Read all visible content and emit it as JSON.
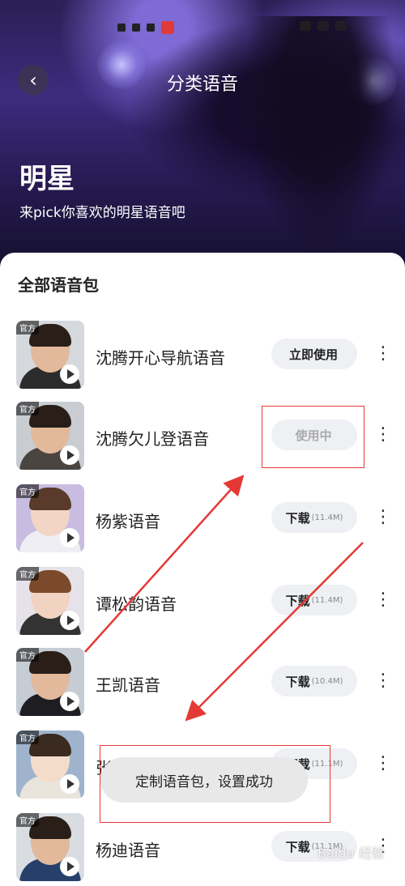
{
  "header": {
    "title": "分类语音",
    "back_label": "‹"
  },
  "hero": {
    "title": "明星",
    "subtitle": "来pick你喜欢的明星语音吧"
  },
  "section_title": "全部语音包",
  "badge": "官方",
  "items": [
    {
      "name": "沈腾开心导航语音",
      "action": "立即使用",
      "size": ""
    },
    {
      "name": "沈腾欠儿登语音",
      "action": "使用中",
      "size": ""
    },
    {
      "name": "杨紫语音",
      "action": "下载",
      "size": "(11.4M)"
    },
    {
      "name": "谭松韵语音",
      "action": "下载",
      "size": "(11.4M)"
    },
    {
      "name": "王凯语音",
      "action": "下载",
      "size": "(10.4M)"
    },
    {
      "name": "张雪迎语音",
      "action": "下载",
      "size": "(11.1M)"
    },
    {
      "name": "杨迪语音",
      "action": "下载",
      "size": "(11.1M)"
    }
  ],
  "toast": "定制语音包，设置成功",
  "watermark": "Baidu 经验",
  "colors": {
    "annotation": "#e53935",
    "button_bg": "#eef0f4"
  }
}
